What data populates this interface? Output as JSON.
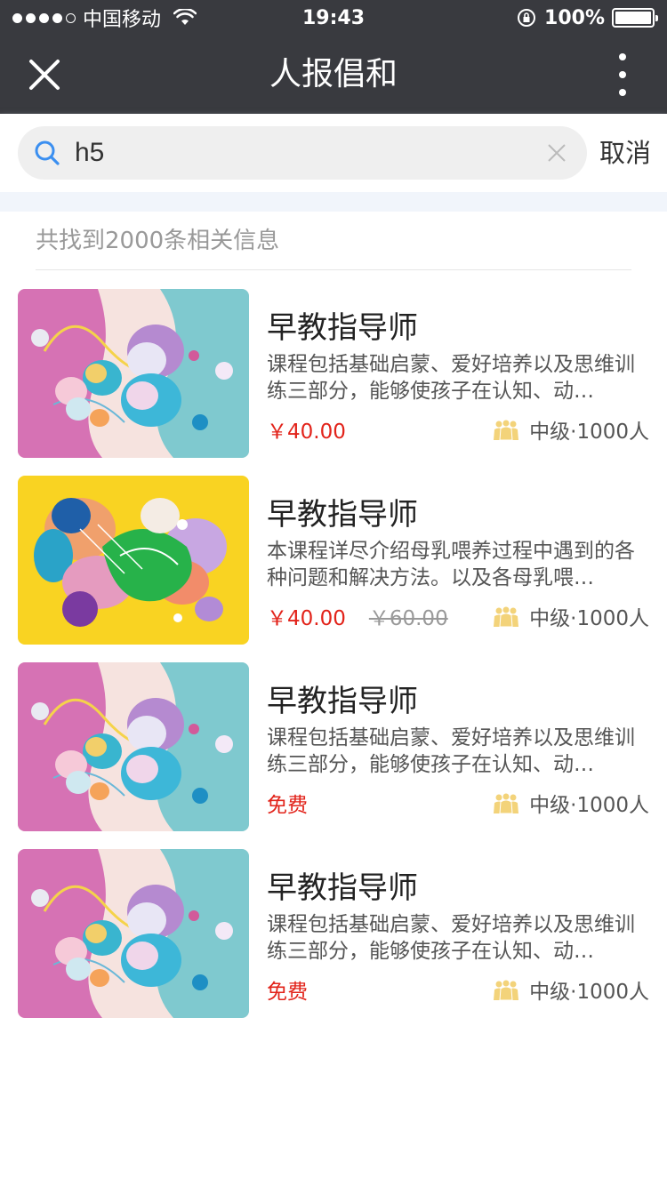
{
  "status_bar": {
    "carrier": "中国移动",
    "time": "19:43",
    "battery": "100%",
    "battery_level": 1.0
  },
  "nav": {
    "title": "人报倡和",
    "close_icon": "close-icon",
    "more_icon": "more-vertical-icon"
  },
  "search": {
    "value": "h5",
    "placeholder": "",
    "cancel_label": "取消"
  },
  "results": {
    "count_text": "共找到2000条相关信息"
  },
  "items": [
    {
      "title": "早教指导师",
      "desc": "课程包括基础启蒙、爱好培养以及思维训练三部分，能够使孩子在认知、动…",
      "price": "￥40.00",
      "original_price": "",
      "meta": "中级·1000人",
      "thumb": "pink"
    },
    {
      "title": "早教指导师",
      "desc": "本课程详尽介绍母乳喂养过程中遇到的各种问题和解决方法。以及各母乳喂…",
      "price": "￥40.00",
      "original_price": "￥60.00",
      "meta": "中级·1000人",
      "thumb": "yellow"
    },
    {
      "title": "早教指导师",
      "desc": "课程包括基础启蒙、爱好培养以及思维训练三部分，能够使孩子在认知、动…",
      "price": "免费",
      "original_price": "",
      "meta": "中级·1000人",
      "thumb": "pink"
    },
    {
      "title": "早教指导师",
      "desc": "课程包括基础启蒙、爱好培养以及思维训练三部分，能够使孩子在认知、动…",
      "price": "免费",
      "original_price": "",
      "meta": "中级·1000人",
      "thumb": "pink"
    }
  ],
  "colors": {
    "nav_bg": "#393a3f",
    "price_red": "#e2231a",
    "people_icon": "#f3d37a"
  }
}
